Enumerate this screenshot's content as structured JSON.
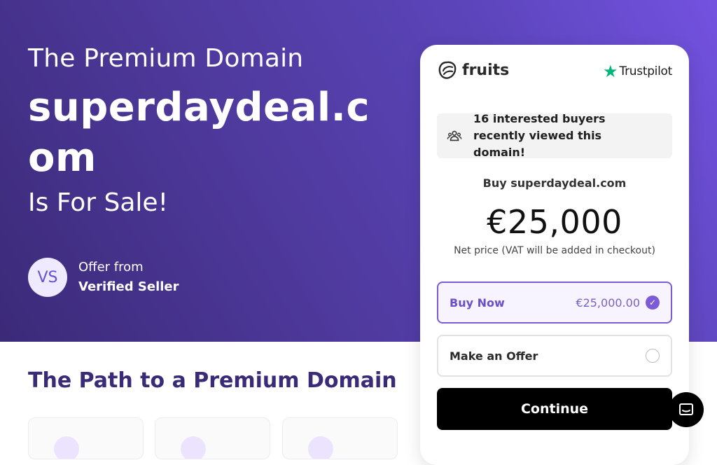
{
  "hero": {
    "pre_title": "The Premium Domain",
    "domain": "superdaydeal.com",
    "post_title": "Is For Sale!",
    "seller": {
      "initials": "VS",
      "label": "Offer from",
      "name": "Verified Seller"
    }
  },
  "path_section": {
    "title": "The Path to a Premium Domain"
  },
  "card": {
    "brand": "fruits",
    "trustpilot": "Trustpilot",
    "notice": "16 interested buyers recently viewed this domain!",
    "buy_label": "Buy superdaydeal.com",
    "price": "€25,000",
    "net_note": "Net price (VAT will be added in checkout)",
    "options": {
      "buy_now": {
        "label": "Buy Now",
        "amount": "€25,000.00",
        "selected": true
      },
      "make_offer": {
        "label": "Make an Offer",
        "selected": false
      }
    },
    "continue_label": "Continue"
  },
  "colors": {
    "hero_gradient_start": "#3b2a78",
    "hero_gradient_end": "#7352e0",
    "accent": "#7b5bd6",
    "trustpilot_green": "#00b67a",
    "section_title": "#3b2a78"
  },
  "icons": {
    "brand": "fruits-logo-icon",
    "trustpilot": "star-icon",
    "notice": "users-icon",
    "selected": "check-icon",
    "chat": "chat-icon"
  }
}
